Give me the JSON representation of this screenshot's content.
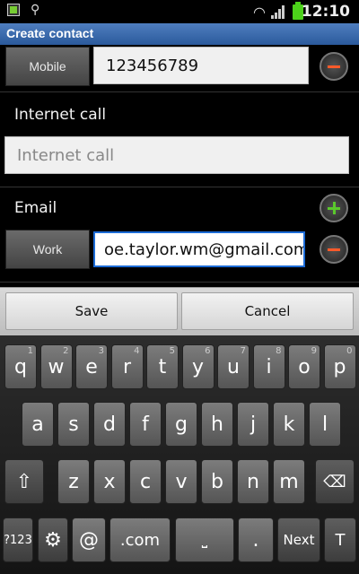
{
  "status_bar": {
    "time": "12:10",
    "battery_small_label": "100%"
  },
  "title_bar": {
    "title": "Create contact"
  },
  "phone": {
    "type_label": "Mobile",
    "value": "123456789"
  },
  "internet_call": {
    "section_label": "Internet call",
    "placeholder": "Internet call"
  },
  "email": {
    "section_label": "Email",
    "type_label": "Work",
    "value": "oe.taylor.wm@gmail.com"
  },
  "actions": {
    "save_label": "Save",
    "cancel_label": "Cancel"
  },
  "keyboard": {
    "row1": [
      {
        "l": "q",
        "n": "1"
      },
      {
        "l": "w",
        "n": "2"
      },
      {
        "l": "e",
        "n": "3"
      },
      {
        "l": "r",
        "n": "4"
      },
      {
        "l": "t",
        "n": "5"
      },
      {
        "l": "y",
        "n": "6"
      },
      {
        "l": "u",
        "n": "7"
      },
      {
        "l": "i",
        "n": "8"
      },
      {
        "l": "o",
        "n": "9"
      },
      {
        "l": "p",
        "n": "0"
      }
    ],
    "row2": [
      "a",
      "s",
      "d",
      "f",
      "g",
      "h",
      "j",
      "k",
      "l"
    ],
    "row3": [
      "z",
      "x",
      "c",
      "v",
      "b",
      "n",
      "m"
    ],
    "sym_label": "?123",
    "at_label": "@",
    "com_label": ".com",
    "dot_label": ".",
    "next_label": "Next"
  }
}
